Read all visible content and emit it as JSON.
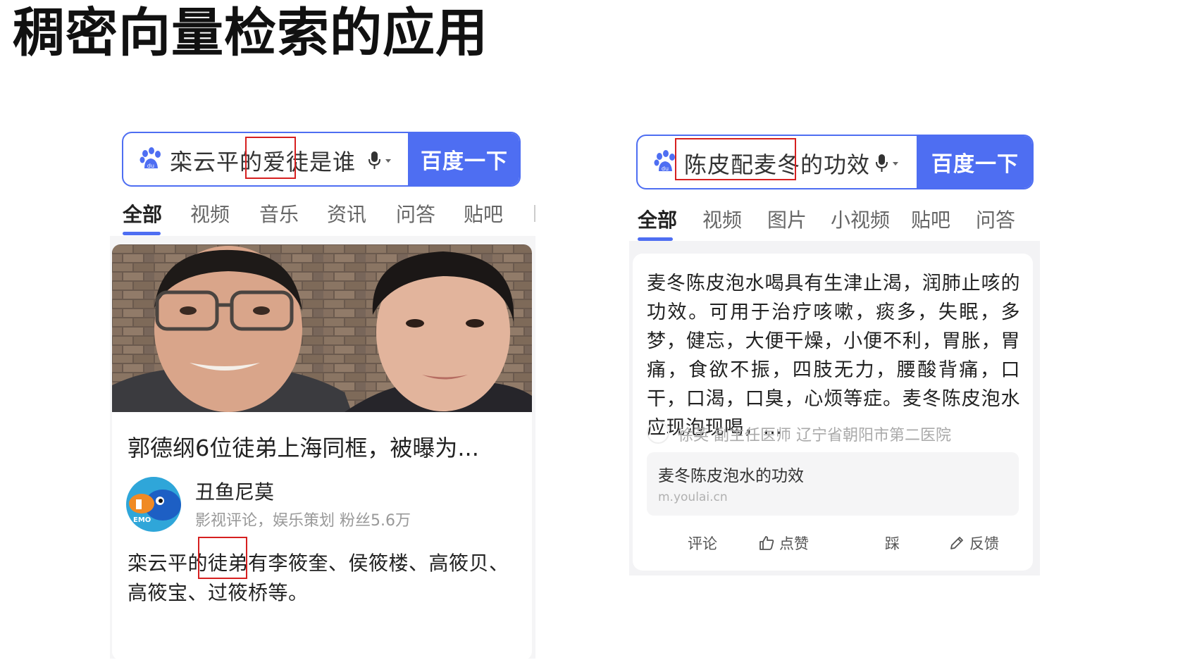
{
  "slide_title": "稠密向量检索的应用",
  "left": {
    "search_query": "栾云平的爱徒是谁",
    "search_button": "百度一下",
    "tabs": [
      "全部",
      "视频",
      "音乐",
      "资讯",
      "问答",
      "贴吧"
    ],
    "news_title": "郭德纲6位徒弟上海同框，被曝为...",
    "author_name": "丑鱼尼莫",
    "author_meta": "影视评论，娱乐策划   粉丝5.6万",
    "avatar_label": "EMO",
    "snippet": "栾云平的徒弟有李筱奎、侯筱楼、高筱贝、高筱宝、过筱桥等。"
  },
  "right": {
    "search_query": "陈皮配麦冬的功效",
    "search_button": "百度一下",
    "tabs": [
      "全部",
      "视频",
      "图片",
      "小视频",
      "贴吧",
      "问答"
    ],
    "answer": "麦冬陈皮泡水喝具有生津止渴，润肺止咳的功效。可用于治疗咳嗽，痰多，失眠，多梦，健忘，大便干燥，小便不利，胃胀，胃痛，食欲不振，四肢无力，腰酸背痛，口干，口渴，口臭，心烦等症。麦冬陈皮泡水应现泡现喝，…",
    "doctor_info": "徐英  副主任医师 辽宁省朝阳市第二医院",
    "source_title": "麦冬陈皮泡水的功效",
    "source_url": "m.youlai.cn",
    "actions": [
      "评论",
      "点赞",
      "踩",
      "反馈"
    ]
  },
  "colors": {
    "accent": "#4e6ef2",
    "highlight_box": "#d62020"
  },
  "icons": [
    "baidu-paw-icon",
    "microphone-icon",
    "thumbs-up-icon",
    "pencil-icon"
  ]
}
